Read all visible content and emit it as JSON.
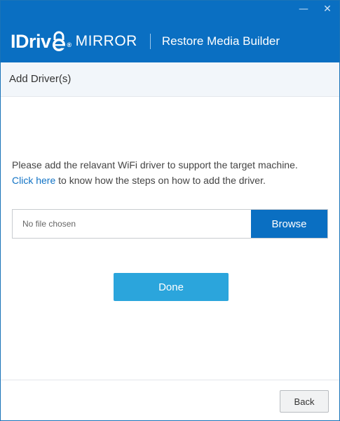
{
  "window": {
    "controls": {
      "minimize": "—",
      "close": "✕"
    }
  },
  "brand": {
    "logo_text_i": "IDriv",
    "logo_text_e": "e",
    "reg_mark": "®",
    "product": "MIRROR",
    "app_title": "Restore Media Builder"
  },
  "section": {
    "title": "Add Driver(s)"
  },
  "content": {
    "description": "Please add the relavant WiFi driver to support the target machine.",
    "link_text": "Click here",
    "link_suffix": " to know how the steps on how to add the driver."
  },
  "file_picker": {
    "value": "No file chosen",
    "browse_label": "Browse"
  },
  "actions": {
    "done_label": "Done",
    "back_label": "Back"
  },
  "colors": {
    "brand_blue": "#0a6fc2",
    "done_blue": "#2ba5dc",
    "link_blue": "#1173c5"
  }
}
